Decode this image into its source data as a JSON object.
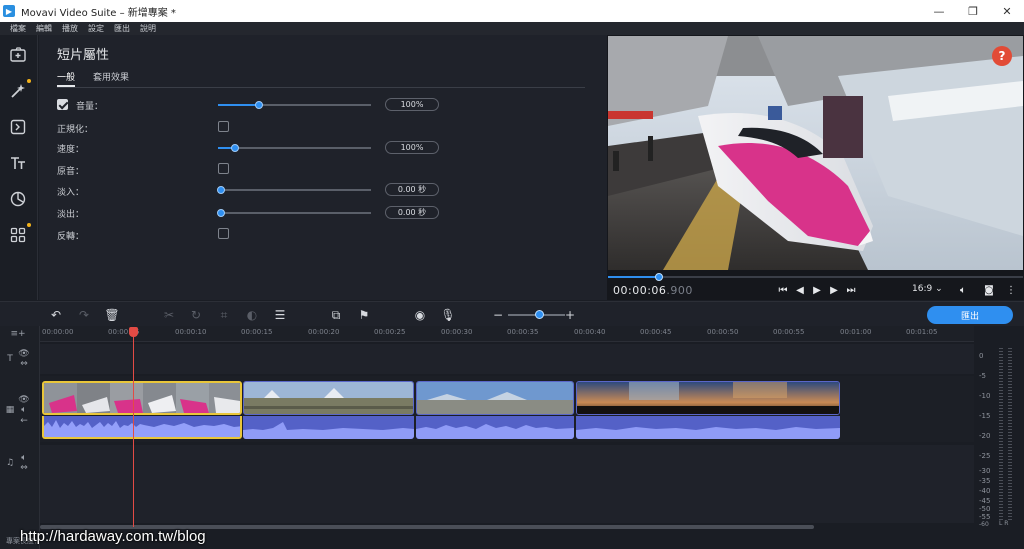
{
  "window": {
    "title": "Movavi Video Suite – 新增專案 *"
  },
  "menu": [
    "檔案",
    "編輯",
    "播放",
    "設定",
    "匯出",
    "說明"
  ],
  "properties": {
    "title": "短片屬性",
    "tabs": [
      "一般",
      "套用效果"
    ],
    "rows": {
      "volume": {
        "label": "音量：",
        "value": "100%",
        "level": 0.27
      },
      "normalize": {
        "label": "正規化："
      },
      "speed": {
        "label": "速度：",
        "value": "100%",
        "level": 0.11
      },
      "original": {
        "label": "原音："
      },
      "fadein": {
        "label": "淡入：",
        "value": "0.00 秒",
        "level": 0.02
      },
      "fadeout": {
        "label": "淡出：",
        "value": "0.00 秒",
        "level": 0.02
      },
      "reverse": {
        "label": "反轉："
      }
    }
  },
  "player": {
    "time_main": "00:00:06",
    "time_frac": ".900",
    "ratio": "16:9 ⌄",
    "help": "?",
    "progress": 0.12
  },
  "toolbar": {
    "export": "匯出"
  },
  "ruler": [
    "00:00:00",
    "00:00:05",
    "00:00:10",
    "00:00:15",
    "00:00:20",
    "00:00:25",
    "00:00:30",
    "00:00:35",
    "00:00:40",
    "00:00:45",
    "00:00:50",
    "00:00:55",
    "00:01:00",
    "00:01:05"
  ],
  "meter": [
    "0",
    "-5",
    "-10",
    "-15",
    "-20",
    "-25",
    "-30",
    "-35",
    "-40",
    "-45",
    "-50",
    "-55",
    "-60"
  ],
  "meter_lr": "L R",
  "status": "專案長度：",
  "watermark": "http://hardaway.com.tw/blog",
  "colors": {
    "accent": "#2f8ff0",
    "playhead": "#e24b45",
    "selection": "#e9c63a",
    "audio": "#5461c7"
  }
}
